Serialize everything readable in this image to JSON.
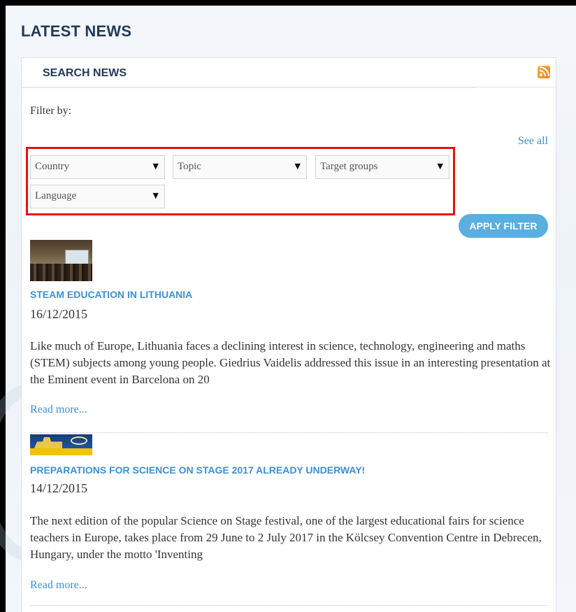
{
  "heading": "LATEST NEWS",
  "search": {
    "title": "SEARCH NEWS",
    "rss_icon": "rss-icon"
  },
  "filters": {
    "label": "Filter by:",
    "see_all": "See all",
    "country": "Country",
    "topic": "Topic",
    "target_groups": "Target groups",
    "language": "Language",
    "caret": "▼",
    "apply": "APPLY FILTER"
  },
  "articles": [
    {
      "title": "STEAM EDUCATION IN LITHUANIA",
      "date": "16/12/2015",
      "text": "Like much of Europe, Lithuania faces a declining interest in science, technology, engineering and maths (STEM) subjects among young people. Giedrius Vaidelis addressed this issue in an interesting presentation at the Eminent event in Barcelona on 20",
      "read_more": "Read more..."
    },
    {
      "title": "PREPARATIONS FOR SCIENCE ON STAGE 2017 ALREADY UNDERWAY!",
      "date": "14/12/2015",
      "text": "The next edition of the popular Science on Stage festival, one of the largest educational fairs for science teachers in Europe, takes place from 29 June to 2 July 2017 in the Kölcsey Convention Centre in Debrecen, Hungary, under the motto 'Inventing",
      "read_more": "Read more..."
    }
  ],
  "colors": {
    "heading": "#1f3a5a",
    "link": "#3d8fd1",
    "button": "#5aaee0",
    "highlight": "#e81010",
    "rss": "#ef7b1d"
  }
}
